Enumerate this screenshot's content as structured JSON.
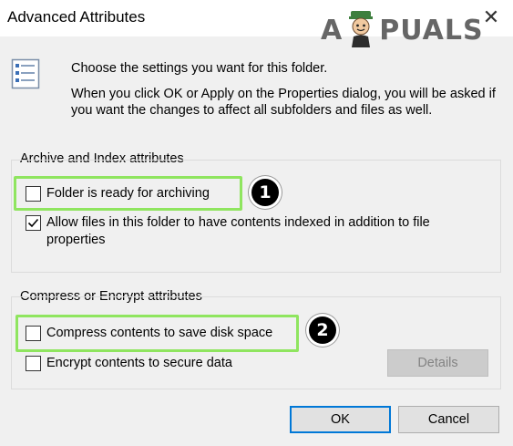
{
  "window": {
    "title": "Advanced Attributes",
    "close_glyph": "✕"
  },
  "watermark": {
    "text_before": "A",
    "text_after": "PUALS"
  },
  "intro": {
    "line1": "Choose the settings you want for this folder.",
    "line2": "When you click OK or Apply on the Properties dialog, you will be asked if you want the changes to affect all subfolders and files as well."
  },
  "archive_group": {
    "label": "Archive and Index attributes",
    "folder_ready": {
      "label": "Folder is ready for archiving",
      "checked": false
    },
    "allow_index": {
      "label": "Allow files in this folder to have contents indexed in addition to file properties",
      "checked": true
    }
  },
  "compress_group": {
    "label": "Compress or Encrypt attributes",
    "compress": {
      "label": "Compress contents to save disk space",
      "checked": false
    },
    "encrypt": {
      "label": "Encrypt contents to secure data",
      "checked": false
    },
    "details_label": "Details"
  },
  "markers": {
    "one": "1",
    "two": "2"
  },
  "buttons": {
    "ok": "OK",
    "cancel": "Cancel"
  },
  "colors": {
    "highlight": "#8fe55f",
    "primary_border": "#0078d7"
  }
}
